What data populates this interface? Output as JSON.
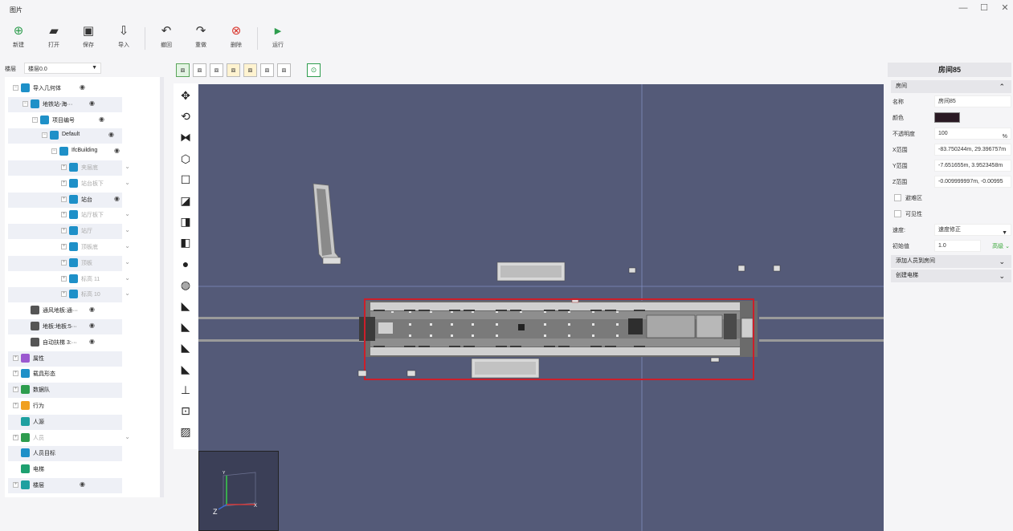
{
  "window": {
    "title": "图片",
    "controls": [
      "—",
      "☐",
      "✕"
    ]
  },
  "toolbar": {
    "buttons": [
      {
        "label": "新建",
        "icon": "add-icon",
        "glyph": "⊕",
        "color": "#2e9d4e"
      },
      {
        "label": "打开",
        "icon": "folder-open-icon",
        "glyph": "▰",
        "color": "#333333"
      },
      {
        "label": "保存",
        "icon": "save-icon",
        "glyph": "▣",
        "color": "#333333"
      },
      {
        "label": "导入",
        "icon": "import-icon",
        "glyph": "⇩",
        "color": "#333333"
      },
      {
        "label": "撤回",
        "icon": "undo-icon",
        "glyph": "↶",
        "color": "#333333"
      },
      {
        "label": "重做",
        "icon": "redo-icon",
        "glyph": "↷",
        "color": "#333333"
      },
      {
        "label": "删除",
        "icon": "delete-icon",
        "glyph": "⊗",
        "color": "#d9342b"
      },
      {
        "label": "运行",
        "icon": "run-icon",
        "glyph": "▶",
        "color": "#2e9d4e"
      }
    ]
  },
  "floor": {
    "label": "楼层",
    "value": "楼层0.0"
  },
  "tree": {
    "nodes": [
      {
        "text": "导入几何体",
        "level": 0,
        "expander": "−",
        "icon_color": "#1e90c8",
        "eye": true,
        "dim": false
      },
      {
        "text": "地铁站-海···",
        "level": 1,
        "expander": "−",
        "icon_color": "#1e90c8",
        "eye": true,
        "dim": false
      },
      {
        "text": "项目编号",
        "level": 2,
        "expander": "−",
        "icon_color": "#1e90c8",
        "eye": true,
        "dim": false
      },
      {
        "text": "Default",
        "level": 3,
        "expander": "−",
        "icon_color": "#1e90c8",
        "eye": true,
        "dim": false
      },
      {
        "text": "IfcBuilding",
        "level": 4,
        "expander": "−",
        "icon_color": "#1e90c8",
        "eye": true,
        "dim": false
      },
      {
        "text": "夹层底",
        "level": 5,
        "expander": "+",
        "icon_color": "#1e90c8",
        "eye": false,
        "dim": true
      },
      {
        "text": "站台板下",
        "level": 5,
        "expander": "+",
        "icon_color": "#1e90c8",
        "eye": false,
        "dim": true
      },
      {
        "text": "站台",
        "level": 5,
        "expander": "+",
        "icon_color": "#1e90c8",
        "eye": true,
        "dim": false
      },
      {
        "text": "站厅板下",
        "level": 5,
        "expander": "+",
        "icon_color": "#1e90c8",
        "eye": false,
        "dim": true
      },
      {
        "text": "站厅",
        "level": 5,
        "expander": "+",
        "icon_color": "#1e90c8",
        "eye": false,
        "dim": true
      },
      {
        "text": "顶板底",
        "level": 5,
        "expander": "+",
        "icon_color": "#1e90c8",
        "eye": false,
        "dim": true
      },
      {
        "text": "顶板",
        "level": 5,
        "expander": "+",
        "icon_color": "#1e90c8",
        "eye": false,
        "dim": true
      },
      {
        "text": "标高 11",
        "level": 5,
        "expander": "+",
        "icon_color": "#1e90c8",
        "eye": false,
        "dim": true
      },
      {
        "text": "标高 10",
        "level": 5,
        "expander": "+",
        "icon_color": "#1e90c8",
        "eye": false,
        "dim": true
      },
      {
        "text": "通风地板:通···",
        "level": 1,
        "expander": "",
        "icon_color": "#555555",
        "eye": true,
        "dim": false
      },
      {
        "text": "地板:地板:5···",
        "level": 1,
        "expander": "",
        "icon_color": "#555555",
        "eye": true,
        "dim": false
      },
      {
        "text": "自动扶梯 3:···",
        "level": 1,
        "expander": "",
        "icon_color": "#555555",
        "eye": true,
        "dim": false
      },
      {
        "text": "属性",
        "level": 0,
        "expander": "+",
        "icon_color": "#9b59d0",
        "eye": false,
        "dim": false
      },
      {
        "text": "载具形态",
        "level": 0,
        "expander": "+",
        "icon_color": "#1e90c8",
        "eye": false,
        "dim": false
      },
      {
        "text": "数据队",
        "level": 0,
        "expander": "+",
        "icon_color": "#2e9d4e",
        "eye": false,
        "dim": false
      },
      {
        "text": "行为",
        "level": 0,
        "expander": "+",
        "icon_color": "#f0a020",
        "eye": false,
        "dim": false
      },
      {
        "text": "人源",
        "level": 0,
        "expander": "",
        "icon_color": "#1ea0a0",
        "eye": false,
        "dim": false
      },
      {
        "text": "人员",
        "level": 0,
        "expander": "+",
        "icon_color": "#2e9d4e",
        "eye": false,
        "dim": true
      },
      {
        "text": "人员目标",
        "level": 0,
        "expander": "",
        "icon_color": "#1e90c8",
        "eye": false,
        "dim": false
      },
      {
        "text": "电梯",
        "level": 0,
        "expander": "",
        "icon_color": "#1ea070",
        "eye": false,
        "dim": false
      },
      {
        "text": "楼层",
        "level": 0,
        "expander": "+",
        "icon_color": "#1ea0a0",
        "eye": true,
        "dim": false
      }
    ]
  },
  "viewbar": {
    "buttons": [
      "view-3d-icon",
      "view-front-icon",
      "view-back-icon",
      "view-top-icon",
      "view-bottom-icon",
      "view-left-icon",
      "view-right-icon"
    ],
    "fit_icon": "fit-view-icon"
  },
  "tools": [
    {
      "name": "move-icon",
      "glyph": "✥"
    },
    {
      "name": "rotate-icon",
      "glyph": "⟲"
    },
    {
      "name": "mirror-icon",
      "glyph": "⧓"
    },
    {
      "name": "polygon-icon",
      "glyph": "⬡"
    },
    {
      "name": "rectangle-icon",
      "glyph": "☐"
    },
    {
      "name": "slab-icon",
      "glyph": "◪"
    },
    {
      "name": "wall-icon",
      "glyph": "◨"
    },
    {
      "name": "door-icon",
      "glyph": "◧"
    },
    {
      "name": "person-icon",
      "glyph": "●"
    },
    {
      "name": "group-icon",
      "glyph": "◍"
    },
    {
      "name": "stairs-1-icon",
      "glyph": "◣"
    },
    {
      "name": "stairs-2-icon",
      "glyph": "◣"
    },
    {
      "name": "ramp-1-icon",
      "glyph": "◣"
    },
    {
      "name": "ramp-2-icon",
      "glyph": "◣"
    },
    {
      "name": "target-icon",
      "glyph": "⊥"
    },
    {
      "name": "people-source-icon",
      "glyph": "⊡"
    },
    {
      "name": "hatch-icon",
      "glyph": "▨"
    }
  ],
  "minimap": {
    "axis_z": "Z",
    "axis_x": "X",
    "axis_y": "Y"
  },
  "properties": {
    "title": "房间85",
    "section_room": "房间",
    "name_label": "名称",
    "name_value": "房间85",
    "color_label": "颜色",
    "color_value": "#2a1a24",
    "opacity_label": "不透明度",
    "opacity_value": "100",
    "opacity_unit": "%",
    "x_label": "X范围",
    "x_value": "-83.750244m, 29.396757m",
    "y_label": "Y范围",
    "y_value": "-7.651655m, 3.9523458m",
    "z_label": "Z范围",
    "z_value": "-0.009999997m, -0.00995",
    "refuge_label": "避难区",
    "visible_label": "可见性",
    "speed_label": "速度:",
    "speed_value": "速度修正",
    "initial_label": "初始值",
    "initial_value": "1.0",
    "advanced_label": "高级",
    "section_add_people": "添加人员到房间",
    "section_create_elevator": "创建电梯"
  }
}
